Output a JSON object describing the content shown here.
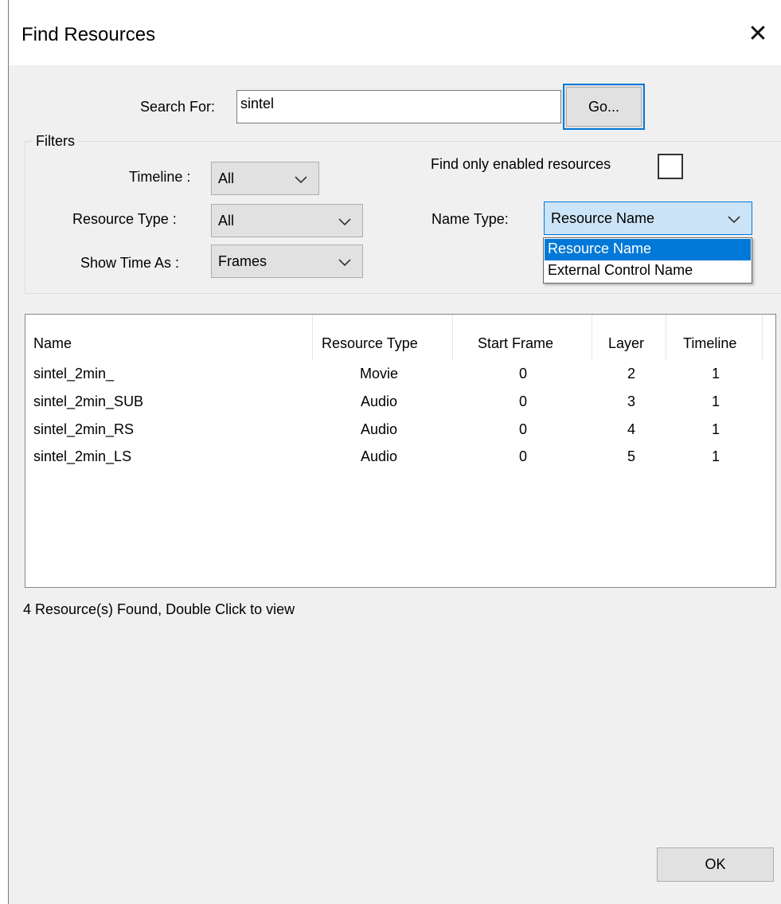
{
  "window": {
    "title": "Find Resources",
    "close_glyph": "✕"
  },
  "search": {
    "label": "Search For:",
    "value": "sintel",
    "go_label": "Go..."
  },
  "filters": {
    "group_label": "Filters",
    "timeline_label": "Timeline :",
    "timeline_value": "All",
    "resource_type_label": "Resource Type :",
    "resource_type_value": "All",
    "show_time_label": "Show Time As :",
    "show_time_value": "Frames",
    "enabled_only_label": "Find only enabled resources",
    "enabled_only_checked": false,
    "name_type_label": "Name Type:",
    "name_type_value": "Resource Name",
    "name_type_options": [
      "Resource Name",
      "External Control Name"
    ]
  },
  "results": {
    "columns": [
      "Name",
      "Resource Type",
      "Start Frame",
      "Layer",
      "Timeline"
    ],
    "rows": [
      {
        "name": "sintel_2min_",
        "type": "Movie",
        "start": "0",
        "layer": "2",
        "timeline": "1"
      },
      {
        "name": "sintel_2min_SUB",
        "type": "Audio",
        "start": "0",
        "layer": "3",
        "timeline": "1"
      },
      {
        "name": "sintel_2min_RS",
        "type": "Audio",
        "start": "0",
        "layer": "4",
        "timeline": "1"
      },
      {
        "name": "sintel_2min_LS",
        "type": "Audio",
        "start": "0",
        "layer": "5",
        "timeline": "1"
      }
    ]
  },
  "status": {
    "text": "4 Resource(s) Found, Double Click to view"
  },
  "footer": {
    "ok_label": "OK"
  },
  "icons": {
    "close": "close-icon",
    "dropdown": "chevron-down-icon"
  },
  "colors": {
    "accent": "#0078d7",
    "dialog_bg": "#f0f0f0",
    "selection": "#0078d7",
    "combo_focus": "#cce4f7"
  }
}
